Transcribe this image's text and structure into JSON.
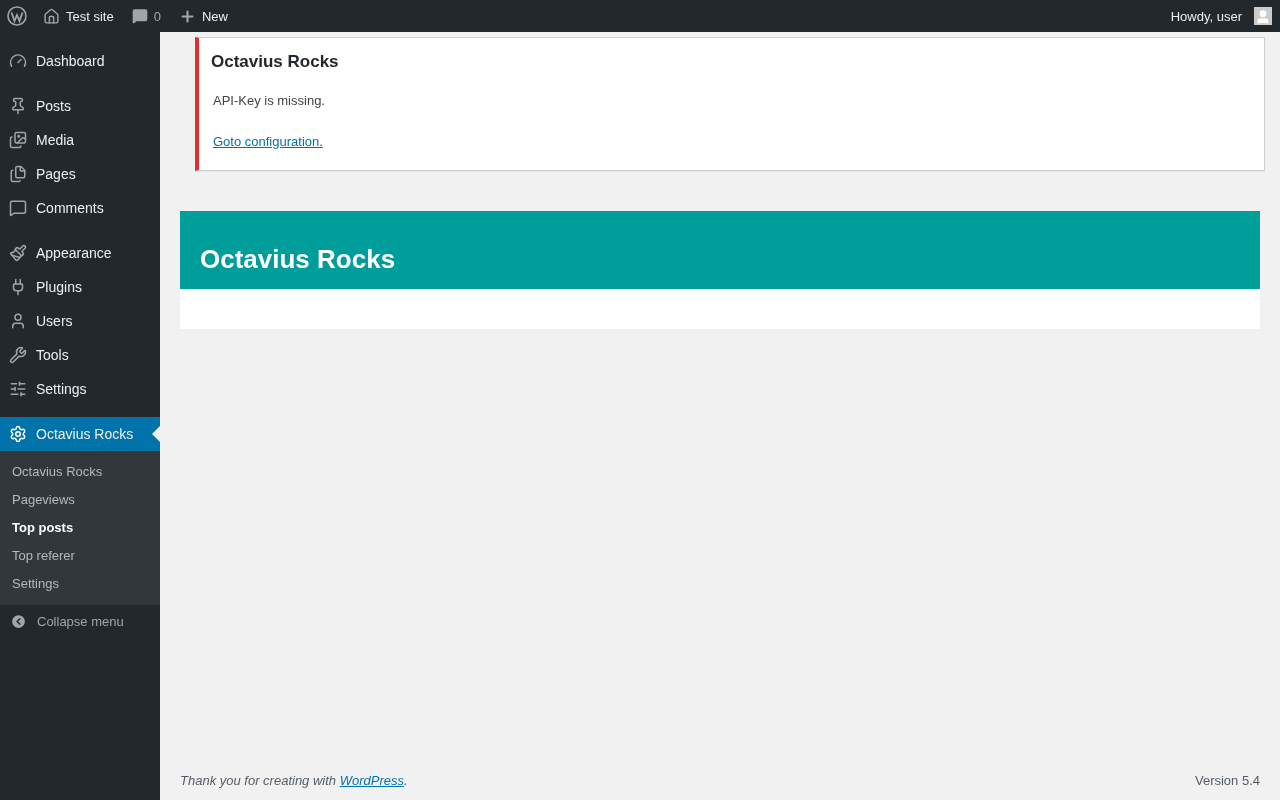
{
  "admin_bar": {
    "site_name": "Test site",
    "comments_count": "0",
    "new_label": "New",
    "greeting": "Howdy, user"
  },
  "sidebar": {
    "groups": [
      {
        "items": [
          {
            "label": "Dashboard",
            "selected": false
          }
        ]
      },
      {
        "items": [
          {
            "label": "Posts",
            "selected": false
          },
          {
            "label": "Media",
            "selected": false
          },
          {
            "label": "Pages",
            "selected": false
          },
          {
            "label": "Comments",
            "selected": false
          }
        ]
      },
      {
        "items": [
          {
            "label": "Appearance",
            "selected": false
          },
          {
            "label": "Plugins",
            "selected": false
          },
          {
            "label": "Users",
            "selected": false
          },
          {
            "label": "Tools",
            "selected": false
          },
          {
            "label": "Settings",
            "selected": false
          }
        ]
      },
      {
        "items": [
          {
            "label": "Octavius Rocks",
            "selected": true
          }
        ]
      }
    ],
    "submenu": [
      {
        "label": "Octavius Rocks",
        "selected": false
      },
      {
        "label": "Pageviews",
        "selected": false
      },
      {
        "label": "Top posts",
        "selected": true
      },
      {
        "label": "Top referer",
        "selected": false
      },
      {
        "label": "Settings",
        "selected": false
      }
    ],
    "collapse_label": "Collapse menu"
  },
  "notice": {
    "title": "Octavius Rocks",
    "message": "API-Key is missing.",
    "link": "Goto configuration."
  },
  "panel": {
    "title": "Octavius Rocks"
  },
  "footer": {
    "thanks": "Thank you for creating with ",
    "link": "WordPress",
    "after_link": ".",
    "version": "Version 5.4"
  }
}
